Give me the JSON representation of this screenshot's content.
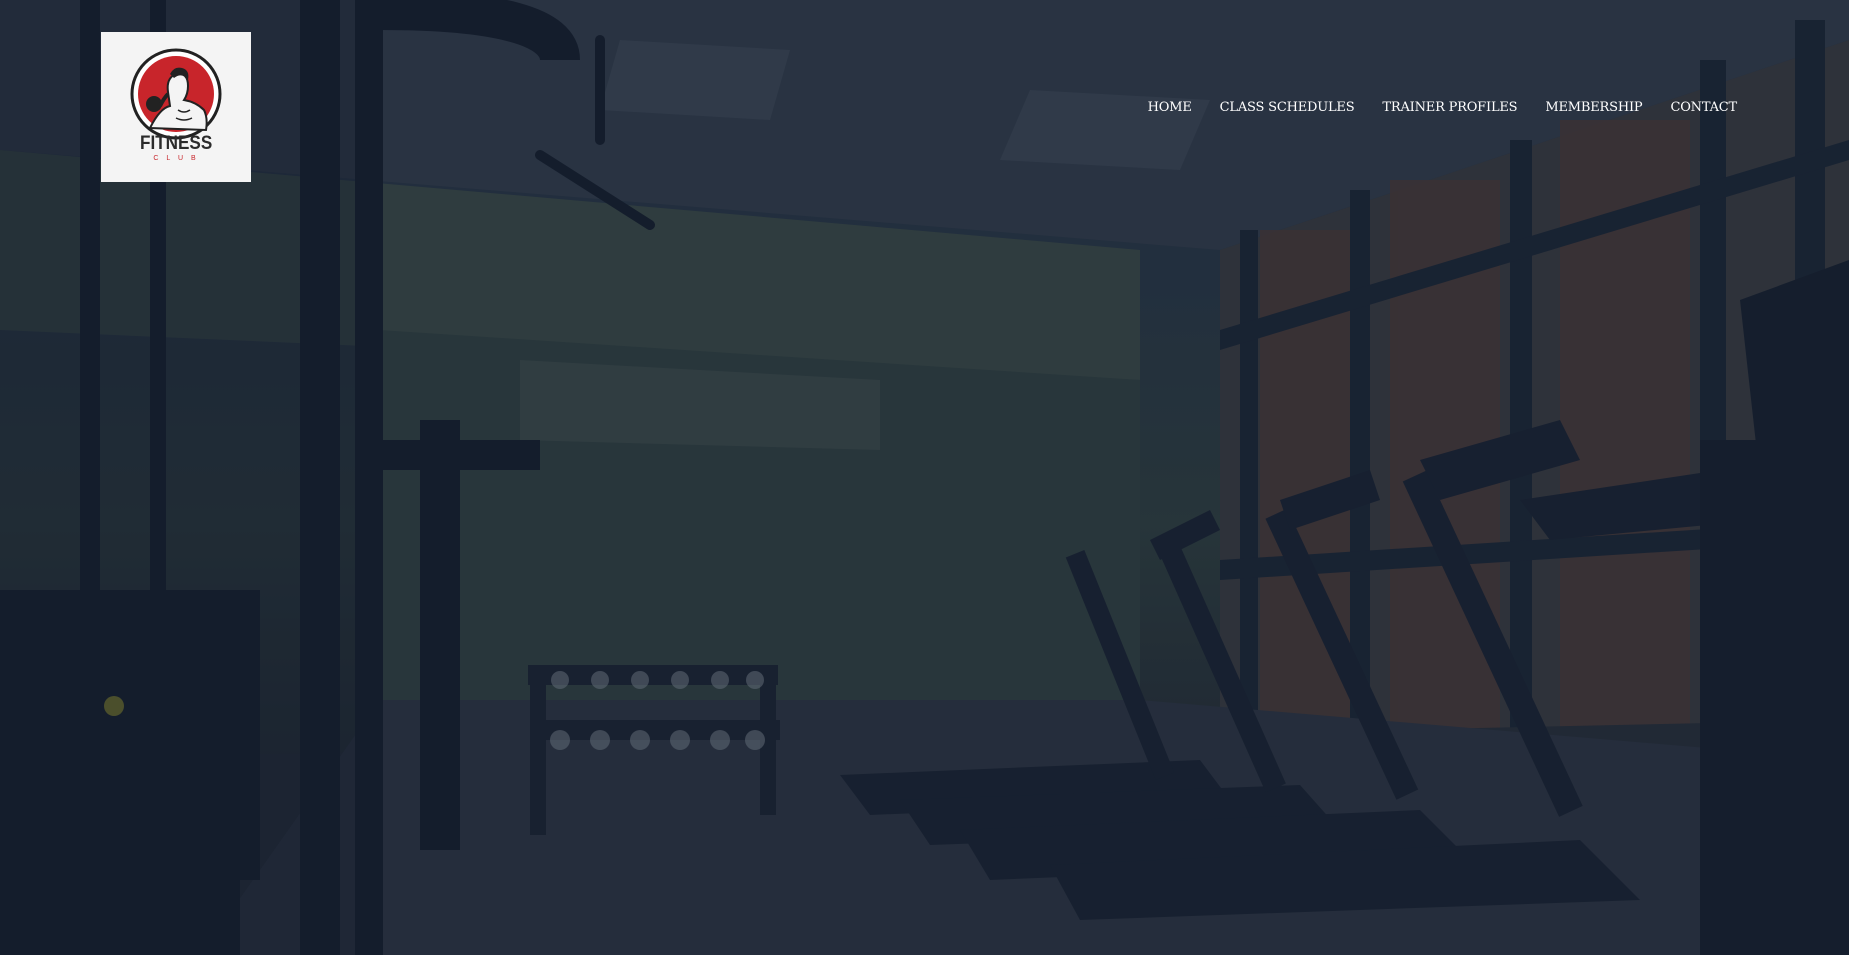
{
  "brand": {
    "name": "FITNESS",
    "tagline": "C L U B",
    "emblem_icon": "bodybuilder-emblem-icon",
    "accent_color": "#c8252b"
  },
  "nav": {
    "items": [
      {
        "label": "HOME"
      },
      {
        "label": "CLASS SCHEDULES"
      },
      {
        "label": "TRAINER PROFILES"
      },
      {
        "label": "MEMBERSHIP"
      },
      {
        "label": "CONTACT"
      }
    ]
  },
  "hero": {
    "background": "gym-interior-photo"
  }
}
